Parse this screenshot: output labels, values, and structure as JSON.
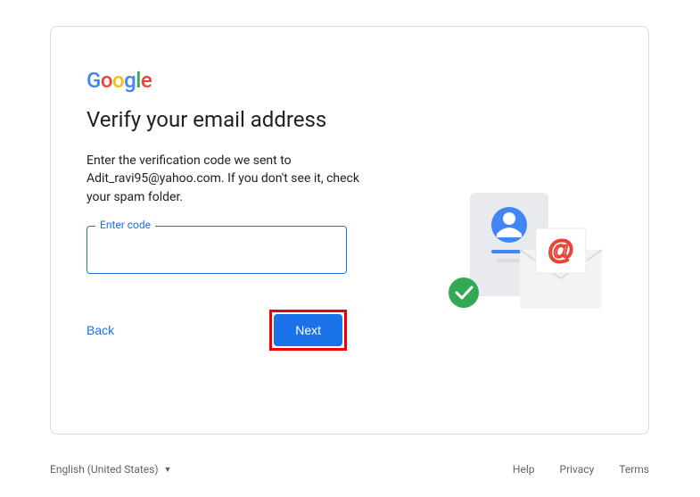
{
  "logo": {
    "g1": "G",
    "o1": "o",
    "o2": "o",
    "g2": "g",
    "l": "l",
    "e": "e"
  },
  "heading": "Verify your email address",
  "instruction": "Enter the verification code we sent to Adit_ravi95@yahoo.com. If you don't see it, check your spam folder.",
  "field": {
    "label": "Enter code",
    "value": ""
  },
  "buttons": {
    "back": "Back",
    "next": "Next"
  },
  "footer": {
    "language": "English (United States)",
    "help": "Help",
    "privacy": "Privacy",
    "terms": "Terms"
  }
}
